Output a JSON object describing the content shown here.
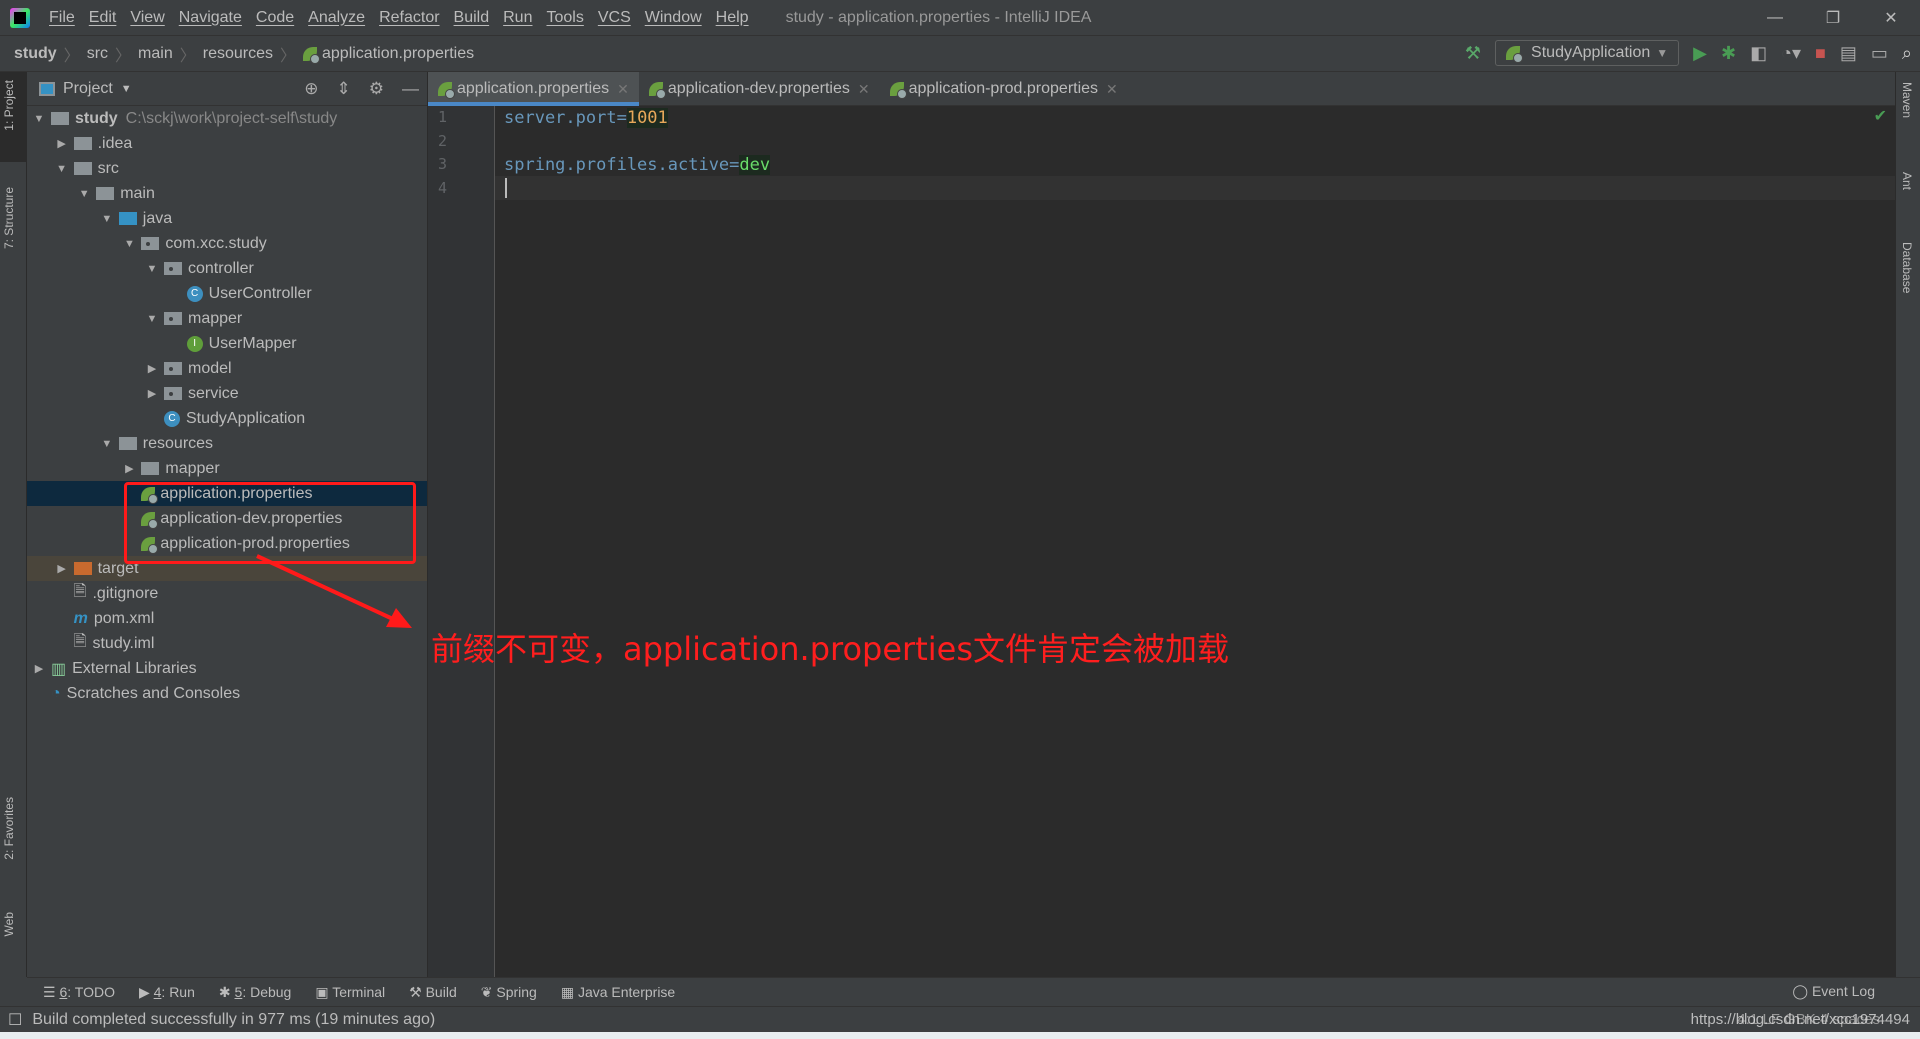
{
  "menu": {
    "items": [
      "File",
      "Edit",
      "View",
      "Navigate",
      "Code",
      "Analyze",
      "Refactor",
      "Build",
      "Run",
      "Tools",
      "VCS",
      "Window",
      "Help"
    ],
    "title": "study - application.properties - IntelliJ IDEA"
  },
  "breadcrumb": [
    "study",
    "src",
    "main",
    "resources",
    "application.properties"
  ],
  "toolbar": {
    "run_config": "StudyApplication"
  },
  "left_strip": {
    "project": "1: Project",
    "structure": "7: Structure",
    "favorites": "2: Favorites",
    "web": "Web"
  },
  "right_strip": {
    "maven": "Maven",
    "ant": "Ant",
    "database": "Database"
  },
  "project": {
    "title": "Project",
    "tree": [
      {
        "label": "study",
        "path": "C:\\sckj\\work\\project-self\\study",
        "level": 0,
        "arrow": "down",
        "icon": "module-folder",
        "bold": true
      },
      {
        "label": ".idea",
        "level": 1,
        "arrow": "right",
        "icon": "folder"
      },
      {
        "label": "src",
        "level": 1,
        "arrow": "down",
        "icon": "folder"
      },
      {
        "label": "main",
        "level": 2,
        "arrow": "down",
        "icon": "folder"
      },
      {
        "label": "java",
        "level": 3,
        "arrow": "down",
        "icon": "source-folder"
      },
      {
        "label": "com.xcc.study",
        "level": 4,
        "arrow": "down",
        "icon": "package"
      },
      {
        "label": "controller",
        "level": 5,
        "arrow": "down",
        "icon": "package"
      },
      {
        "label": "UserController",
        "level": 6,
        "icon": "class"
      },
      {
        "label": "mapper",
        "level": 5,
        "arrow": "down",
        "icon": "package"
      },
      {
        "label": "UserMapper",
        "level": 6,
        "icon": "interface"
      },
      {
        "label": "model",
        "level": 5,
        "arrow": "right",
        "icon": "package"
      },
      {
        "label": "service",
        "level": 5,
        "arrow": "right",
        "icon": "package"
      },
      {
        "label": "StudyApplication",
        "level": 5,
        "icon": "spring-boot-class"
      },
      {
        "label": "resources",
        "level": 3,
        "arrow": "down",
        "icon": "resources-folder"
      },
      {
        "label": "mapper",
        "level": 4,
        "arrow": "right",
        "icon": "folder"
      },
      {
        "label": "application.properties",
        "level": 4,
        "icon": "spring-properties",
        "selected": true
      },
      {
        "label": "application-dev.properties",
        "level": 4,
        "icon": "spring-properties"
      },
      {
        "label": "application-prod.properties",
        "level": 4,
        "icon": "spring-properties"
      },
      {
        "label": "target",
        "level": 1,
        "arrow": "right",
        "icon": "excluded-folder",
        "excluded": true
      },
      {
        "label": ".gitignore",
        "level": 1,
        "icon": "ignore-file"
      },
      {
        "label": "pom.xml",
        "level": 1,
        "icon": "maven"
      },
      {
        "label": "study.iml",
        "level": 1,
        "icon": "iml-file"
      },
      {
        "label": "External Libraries",
        "level": 0,
        "arrow": "right",
        "icon": "libraries"
      },
      {
        "label": "Scratches and Consoles",
        "level": 0,
        "icon": "scratches"
      }
    ]
  },
  "tabs": [
    {
      "label": "application.properties",
      "active": true
    },
    {
      "label": "application-dev.properties"
    },
    {
      "label": "application-prod.properties"
    }
  ],
  "editor": {
    "lines": [
      {
        "n": "1",
        "key": "server.port=",
        "value": "1001",
        "type": "num"
      },
      {
        "n": "2",
        "key": "",
        "value": ""
      },
      {
        "n": "3",
        "key": "spring.profiles.active=",
        "value": "dev",
        "type": "val"
      },
      {
        "n": "4",
        "key": "",
        "value": ""
      }
    ]
  },
  "annotation": "前缀不可变，application.properties文件肯定会被加载",
  "tool_buttons": [
    {
      "key": "6",
      "label": ": TODO"
    },
    {
      "key": "4",
      "label": ": Run"
    },
    {
      "key": "5",
      "label": ": Debug"
    },
    {
      "key": "",
      "label": "Terminal"
    },
    {
      "key": "",
      "label": "Build"
    },
    {
      "key": "",
      "label": "Spring"
    },
    {
      "key": "",
      "label": "Java Enterprise"
    }
  ],
  "event_log": "Event Log",
  "status": {
    "message": "Build completed successfully in 977 ms (19 minutes ago)",
    "right": "4:1  LF  GBK  4 spaces",
    "watermark": "https://blog.csdn.net/xcc1974494"
  },
  "colors": {
    "accent": "#4a88c7",
    "annotation": "#ff1e1e",
    "selection": "#0d293e"
  }
}
